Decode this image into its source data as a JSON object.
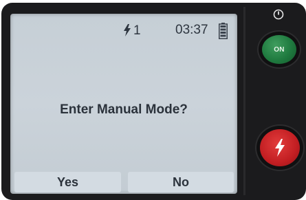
{
  "status_bar": {
    "flash_icon": "lightning-icon",
    "flash_count": "1",
    "time": "03:37",
    "battery_icon": "battery-icon"
  },
  "dialog": {
    "message": "Enter Manual Mode?"
  },
  "softkeys": {
    "yes_label": "Yes",
    "no_label": "No"
  },
  "controls": {
    "power_icon": "power-icon",
    "on_button_label": "ON",
    "on_button_color": "#1f7a3f",
    "flash_button_icon": "lightning-icon",
    "flash_button_color": "#c21e22"
  }
}
